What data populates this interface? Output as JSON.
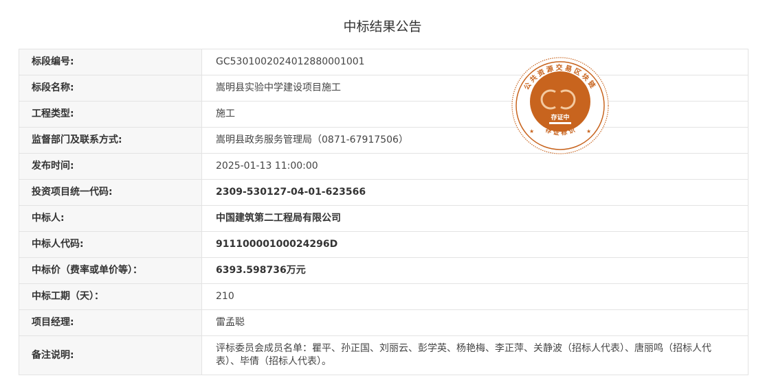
{
  "page": {
    "title": "中标结果公告"
  },
  "rows": [
    {
      "label": "标段编号:",
      "value": "GC5301002024012880001001"
    },
    {
      "label": "标段名称:",
      "value": "嵩明县实验中学建设项目施工"
    },
    {
      "label": "工程类型:",
      "value": "施工"
    },
    {
      "label": "监督部门及联系方式:",
      "value": "嵩明县政务服务管理局（0871-67917506）"
    },
    {
      "label": "发布时间:",
      "value": "2025-01-13 11:00:00"
    },
    {
      "label": "投资项目统一代码:",
      "value": "2309-530127-04-01-623566"
    },
    {
      "label": "中标人:",
      "value": "中国建筑第二工程局有限公司"
    },
    {
      "label": "中标人代码:",
      "value": "91110000100024296D"
    },
    {
      "label": "中标价（费率或单价等）：",
      "value": "6393.598736万元"
    },
    {
      "label": "中标工期（天）：",
      "value": "210"
    },
    {
      "label": "项目经理:",
      "value": "雷孟聪"
    },
    {
      "label": "备注说明:",
      "value": "评标委员会成员名单：瞿平、孙正国、刘丽云、彭学英、杨艳梅、李正萍、关静波（招标人代表）、唐丽鸣（招标人代表）、毕倩（招标人代表）。"
    }
  ],
  "seal": {
    "ring_text": "公共资源交易区块链",
    "center_text": "存证中",
    "bottom_text": "存 证 标 识",
    "color": "#c8641e"
  }
}
